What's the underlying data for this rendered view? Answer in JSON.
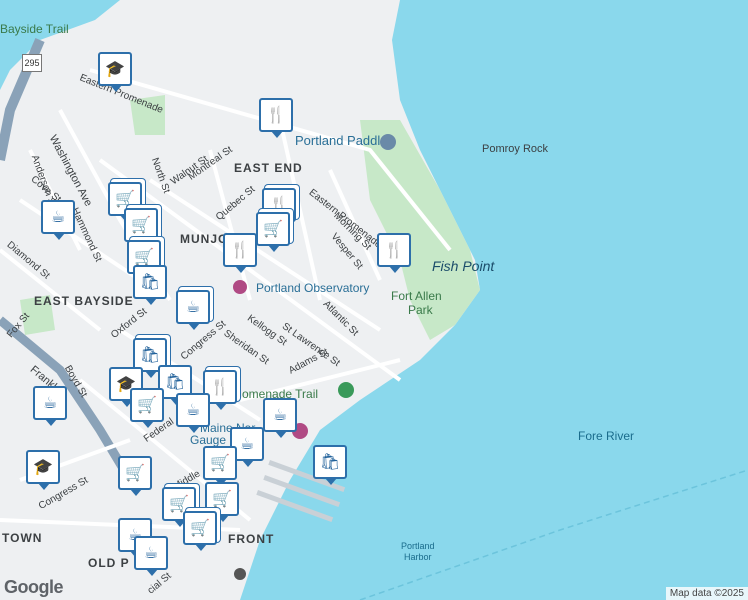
{
  "colors": {
    "water": "#8ad8ec",
    "land": "#eef0f2",
    "park": "#c7e8c8",
    "road": "#ffffff",
    "highway": "#8aa2b8",
    "pin_border": "#2d6faa",
    "pin_icon": "#1e5f99"
  },
  "labels": {
    "bayside_trail": "Bayside Trail",
    "east_promenade": "Eastern Promenade",
    "portland_paddle": "Portland Paddle",
    "pomroy_rock": "Pomroy Rock",
    "east_end": "EAST END",
    "walnut_st": "Walnut St",
    "north_st": "North St",
    "montreal_st": "Montreal St",
    "eastern_promenade": "Eastern Promenade",
    "quebec_st": "Quebec St",
    "washington_ave": "Washington Ave",
    "anderson_st": "Anderson St",
    "hammond_st": "Hammond St",
    "cove_st": "Cove St",
    "diamond_st": "Diamond St",
    "morning_st": "Morning St",
    "vesper_st": "Vesper St",
    "fish_point": "Fish Point",
    "munjoy_hill": "MUNJO",
    "portland_observatory": "Portland Observatory",
    "fort_allen_park_1": "Fort Allen",
    "fort_allen_park_2": "Park",
    "east_bayside": "EAST BAYSIDE",
    "oxford_st": "Oxford St",
    "congress_st": "Congress St",
    "kellogg_st": "Kellogg St",
    "sheridan_st": "Sheridan St",
    "atlantic_st": "Atlantic St",
    "st_lawrence_st": "St Lawrence St",
    "adams_st": "Adams St",
    "fox_st": "Fox St",
    "boyd_st": "Boyd St",
    "franklin_st": "Frankl",
    "promenade_trail": "omenade Trail",
    "federal_st": "Federal",
    "maine_narrow_gauge": "Maine Nar",
    "gauge_rr": "Gauge",
    "fore_river": "Fore River",
    "congress_st_2": "Congress St",
    "middle_st": "Middle",
    "town": "TOWN",
    "old_port": "OLD P",
    "front": "FRONT",
    "portland_harbor_1": "Portland",
    "portland_harbor_2": "Harbor",
    "commercial_st": "cial St",
    "hwy_295": "295",
    "google": "Google",
    "attribution": "Map data ©2025"
  },
  "pins": [
    {
      "icon": "school-icon",
      "glyph": "🎓"
    },
    {
      "icon": "restaurant-icon",
      "glyph": "🍴"
    },
    {
      "icon": "shopping-cart-icon",
      "glyph": "🛒"
    },
    {
      "icon": "coffee-icon",
      "glyph": "☕"
    },
    {
      "icon": "shopping-bag-icon",
      "glyph": "🛍"
    }
  ]
}
